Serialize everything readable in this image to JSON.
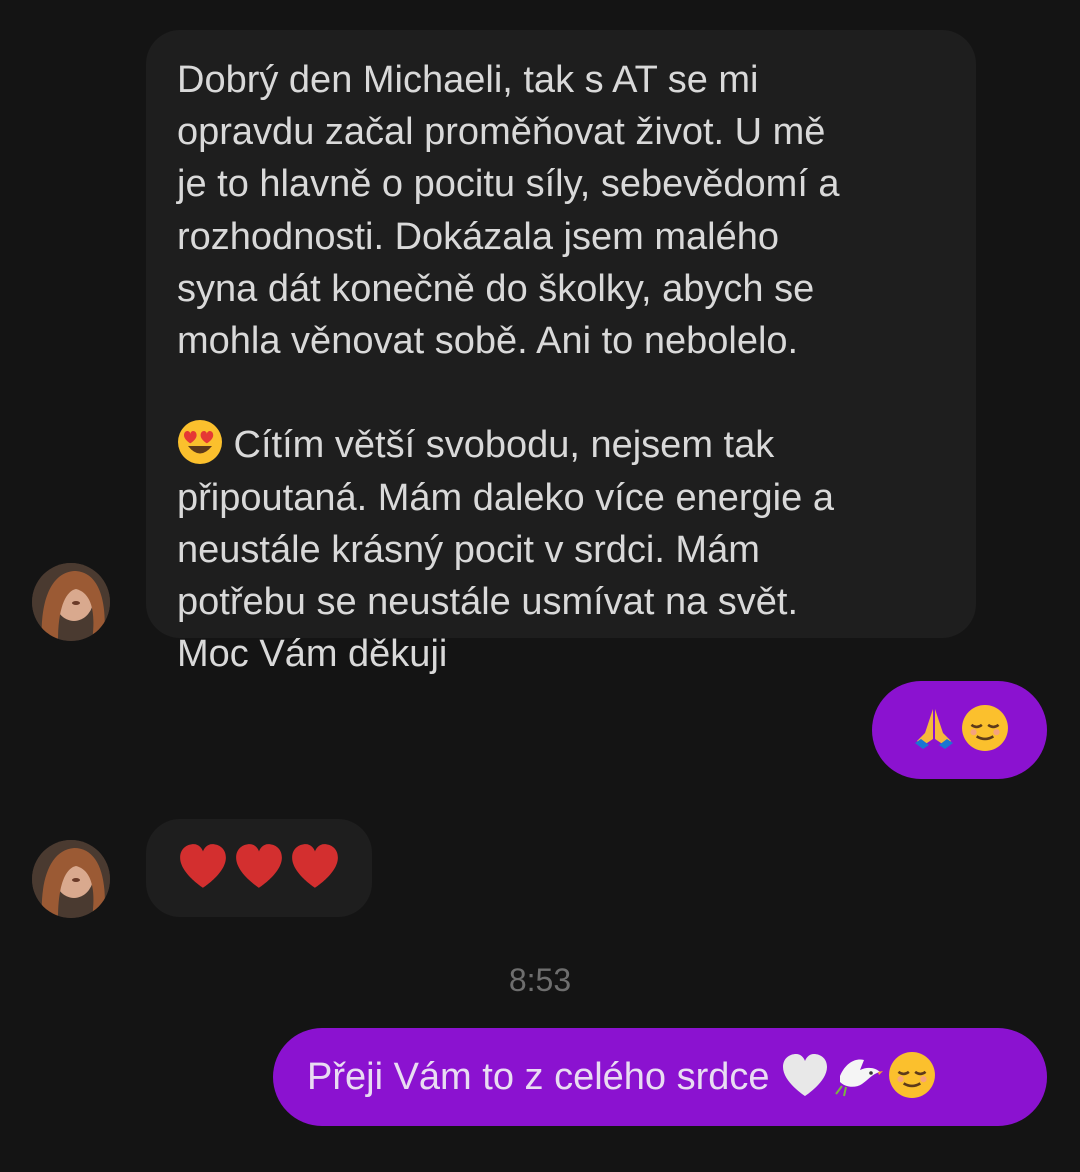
{
  "conversation": {
    "messages": [
      {
        "direction": "incoming",
        "text": "Dobrý den Michaeli, tak s AT se mi\nopravdu začal proměňovat život. U mě\nje to hlavně o pocitu síly, sebevědomí a\nrozhodnosti. Dokázala jsem malého\nsyna dát konečně do školky, abych se\nmohla věnovat sobě. Ani to nebolelo.",
        "emoji_inline": "smiling-face-with-heart-eyes",
        "text_after_emoji": " Cítím větší svobodu, nejsem tak\npřipoutaná. Mám daleko více energie a\nneustále krásný pocit v srdci. Mám\npotřebu se neustále usmívat na svět.\nMoc Vám děkuji"
      },
      {
        "direction": "outgoing",
        "emojis": [
          "folded-hands",
          "relieved-face"
        ]
      },
      {
        "direction": "incoming",
        "emojis": [
          "red-heart",
          "red-heart",
          "red-heart"
        ]
      },
      {
        "direction": "outgoing",
        "text": "Přeji Vám to z celého srdce",
        "emojis": [
          "white-heart",
          "dove",
          "relieved-face"
        ]
      }
    ],
    "timestamp": "8:53"
  },
  "colors": {
    "background": "#141414",
    "incoming_bubble": "#1e1e1e",
    "outgoing_bubble": "#8b12d0",
    "incoming_text": "#d9d9d9",
    "outgoing_text": "#e9dcf2",
    "timestamp_text": "#6e6e6e"
  }
}
